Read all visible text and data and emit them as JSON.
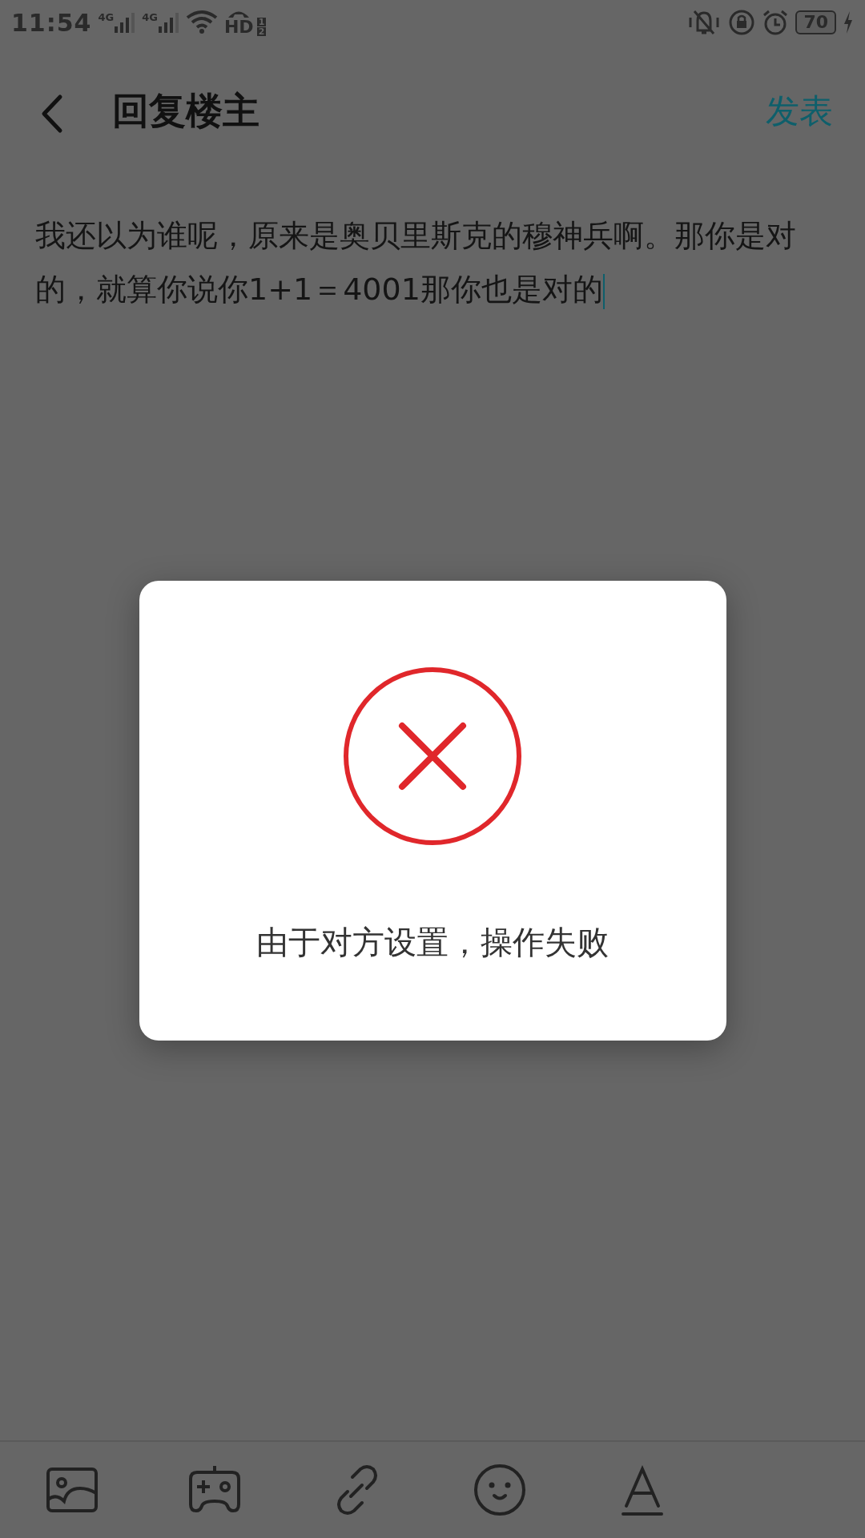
{
  "status_bar": {
    "time": "11:54",
    "sim_labels": [
      "4G",
      "4G"
    ],
    "hd_label": "HD",
    "hd_slots": [
      "1",
      "2"
    ],
    "battery": "70"
  },
  "header": {
    "title": "回复楼主",
    "action": "发表"
  },
  "editor": {
    "value": "我还以为谁呢，原来是奥贝里斯克的穆神兵啊。那你是对的，就算你说你1+1＝4001那你也是对的"
  },
  "dialog": {
    "message": "由于对方设置，操作失败"
  }
}
